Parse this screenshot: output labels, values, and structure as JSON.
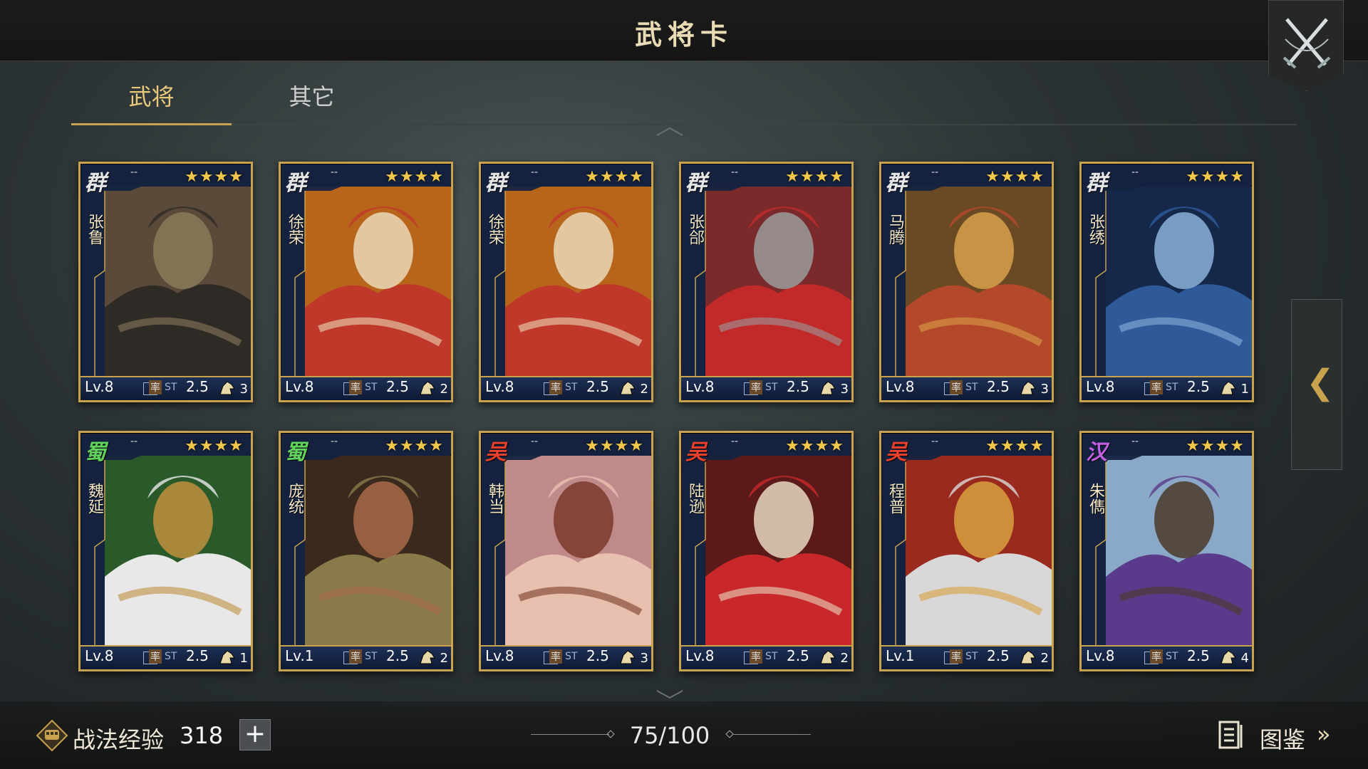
{
  "header": {
    "title": "武将卡"
  },
  "tabs": [
    {
      "label": "武将",
      "active": true
    },
    {
      "label": "其它",
      "active": false
    }
  ],
  "cards": [
    {
      "faction": "群",
      "faction_color": "#e6e6e6",
      "name": "张鲁",
      "dash": "--",
      "stars": "★★★★",
      "level": "Lv.8",
      "cost_label": "率",
      "cost_tag": "ST",
      "cost": "2.5",
      "troop": "3",
      "portrait_colors": [
        "#5b4a3a",
        "#2e2a26",
        "#8a7a5a"
      ]
    },
    {
      "faction": "群",
      "faction_color": "#e6e6e6",
      "name": "徐荣",
      "dash": "--",
      "stars": "★★★★",
      "level": "Lv.8",
      "cost_label": "率",
      "cost_tag": "ST",
      "cost": "2.5",
      "troop": "2",
      "portrait_colors": [
        "#b8651c",
        "#c0382a",
        "#e9d8b8"
      ]
    },
    {
      "faction": "群",
      "faction_color": "#e6e6e6",
      "name": "徐荣",
      "dash": "--",
      "stars": "★★★★",
      "level": "Lv.8",
      "cost_label": "率",
      "cost_tag": "ST",
      "cost": "2.5",
      "troop": "2",
      "portrait_colors": [
        "#b8651c",
        "#c0382a",
        "#e9d8b8"
      ]
    },
    {
      "faction": "群",
      "faction_color": "#e6e6e6",
      "name": "张郃",
      "dash": "--",
      "stars": "★★★★",
      "level": "Lv.8",
      "cost_label": "率",
      "cost_tag": "ST",
      "cost": "2.5",
      "troop": "3",
      "portrait_colors": [
        "#7a2a2a",
        "#c22a2a",
        "#9a9a9a"
      ]
    },
    {
      "faction": "群",
      "faction_color": "#e6e6e6",
      "name": "马腾",
      "dash": "--",
      "stars": "★★★★",
      "level": "Lv.8",
      "cost_label": "率",
      "cost_tag": "ST",
      "cost": "2.5",
      "troop": "3",
      "portrait_colors": [
        "#6a4a24",
        "#b4482a",
        "#d7a04a"
      ]
    },
    {
      "faction": "群",
      "faction_color": "#e6e6e6",
      "name": "张绣",
      "dash": "--",
      "stars": "★★★★",
      "level": "Lv.8",
      "cost_label": "率",
      "cost_tag": "ST",
      "cost": "2.5",
      "troop": "1",
      "portrait_colors": [
        "#16284a",
        "#2e5a9a",
        "#8ab0d8"
      ]
    },
    {
      "faction": "蜀",
      "faction_color": "#5fd35a",
      "name": "魏延",
      "dash": "--",
      "stars": "★★★★",
      "level": "Lv.8",
      "cost_label": "率",
      "cost_tag": "ST",
      "cost": "2.5",
      "troop": "1",
      "portrait_colors": [
        "#2a5a2a",
        "#e8e8e8",
        "#c09040"
      ]
    },
    {
      "faction": "蜀",
      "faction_color": "#5fd35a",
      "name": "庞统",
      "dash": "--",
      "stars": "★★★★",
      "level": "Lv.1",
      "cost_label": "率",
      "cost_tag": "ST",
      "cost": "2.5",
      "troop": "2",
      "portrait_colors": [
        "#3a2a1e",
        "#8a7a4a",
        "#a86a4a"
      ]
    },
    {
      "faction": "吴",
      "faction_color": "#e8402a",
      "name": "韩当",
      "dash": "--",
      "stars": "★★★★",
      "level": "Lv.8",
      "cost_label": "率",
      "cost_tag": "ST",
      "cost": "2.5",
      "troop": "3",
      "portrait_colors": [
        "#c08a8a",
        "#e8c0b0",
        "#7a3a2a"
      ]
    },
    {
      "faction": "吴",
      "faction_color": "#e8402a",
      "name": "陆逊",
      "dash": "--",
      "stars": "★★★★",
      "level": "Lv.8",
      "cost_label": "率",
      "cost_tag": "ST",
      "cost": "2.5",
      "troop": "2",
      "portrait_colors": [
        "#5a1a1a",
        "#c8282a",
        "#e8d8c0"
      ]
    },
    {
      "faction": "吴",
      "faction_color": "#e8402a",
      "name": "程普",
      "dash": "--",
      "stars": "★★★★",
      "level": "Lv.1",
      "cost_label": "率",
      "cost_tag": "ST",
      "cost": "2.5",
      "troop": "2",
      "portrait_colors": [
        "#9a2a1e",
        "#d8d8d8",
        "#d8a040"
      ]
    },
    {
      "faction": "汉",
      "faction_color": "#c060e0",
      "name": "朱儁",
      "dash": "--",
      "stars": "★★★★",
      "level": "Lv.8",
      "cost_label": "率",
      "cost_tag": "ST",
      "cost": "2.5",
      "troop": "4",
      "portrait_colors": [
        "#8aa8c8",
        "#5a3a8a",
        "#4a3a2a"
      ]
    }
  ],
  "footer": {
    "exp_label": "战法经验",
    "exp_value": "318",
    "plus_label": "+",
    "page_count": "75/100",
    "catalog_label": "图鉴",
    "catalog_arrow": "»"
  },
  "side_tab": {
    "arrow": "❮"
  },
  "icons": {
    "close": "crossed-swords-icon",
    "exp": "fist-badge-icon",
    "catalog": "book-icon",
    "troop": "cavalry-icon"
  },
  "colors": {
    "gold_accent": "#c9a24e",
    "star": "#f3c74a",
    "card_blue": "#14233f"
  }
}
